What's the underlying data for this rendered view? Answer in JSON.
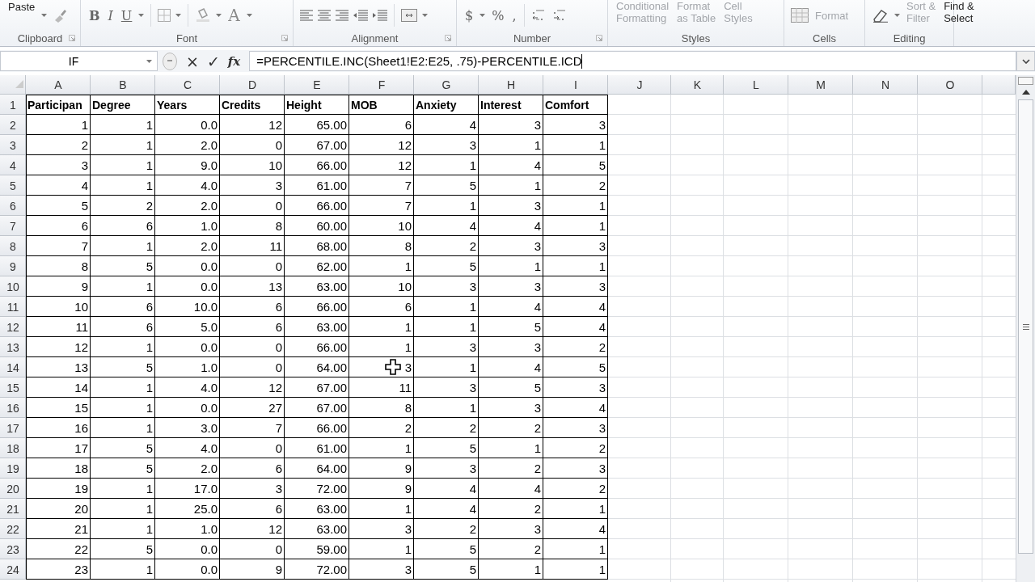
{
  "ribbon": {
    "groups": [
      {
        "label": "Clipboard",
        "buttons": [
          {
            "label": "Paste"
          }
        ]
      },
      {
        "label": "Font",
        "buttons": [
          {
            "label": "B"
          },
          {
            "label": "I"
          },
          {
            "label": "U"
          },
          {
            "label": "A"
          }
        ]
      },
      {
        "label": "Alignment"
      },
      {
        "label": "Number",
        "buttons": [
          {
            "label": "$"
          },
          {
            "label": "%"
          },
          {
            "label": ","
          }
        ]
      },
      {
        "label": "Styles",
        "buttons": [
          {
            "label": "Conditional\nFormatting",
            "disabled": true
          },
          {
            "label": "Format\nas Table",
            "disabled": true
          },
          {
            "label": "Cell\nStyles",
            "disabled": true
          }
        ]
      },
      {
        "label": "Cells",
        "buttons": [
          {
            "label": "Format",
            "disabled": true
          }
        ]
      },
      {
        "label": "Editing",
        "buttons": [
          {
            "label": "Sort &\nFilter",
            "disabled": true
          },
          {
            "label": "Find &\nSelect",
            "disabled": false
          }
        ]
      }
    ]
  },
  "formula_bar": {
    "name_box": "IF",
    "buttons": [
      "×",
      "✓",
      "fx"
    ],
    "formula": "=PERCENTILE.INC(Sheet1!E2:E25, .75)-PERCENTILE.ICD"
  },
  "sheet": {
    "columns": [
      "A",
      "B",
      "C",
      "D",
      "E",
      "F",
      "G",
      "H",
      "I",
      "J",
      "K",
      "L",
      "M",
      "N",
      "O"
    ],
    "header": {
      "number": "1",
      "cells": [
        "Participan",
        "Degree",
        "Years",
        "Credits",
        "Height",
        "MOB",
        "Anxiety",
        "Interest",
        "Comfort"
      ]
    },
    "rows": [
      {
        "number": "2",
        "cells": [
          "1",
          "1",
          "0.0",
          "12",
          "65.00",
          "6",
          "4",
          "3",
          "3"
        ]
      },
      {
        "number": "3",
        "cells": [
          "2",
          "1",
          "2.0",
          "0",
          "67.00",
          "12",
          "3",
          "1",
          "1"
        ]
      },
      {
        "number": "4",
        "cells": [
          "3",
          "1",
          "9.0",
          "10",
          "66.00",
          "12",
          "1",
          "4",
          "5"
        ]
      },
      {
        "number": "5",
        "cells": [
          "4",
          "1",
          "4.0",
          "3",
          "61.00",
          "7",
          "5",
          "1",
          "2"
        ]
      },
      {
        "number": "6",
        "cells": [
          "5",
          "2",
          "2.0",
          "0",
          "66.00",
          "7",
          "1",
          "3",
          "1"
        ]
      },
      {
        "number": "7",
        "cells": [
          "6",
          "6",
          "1.0",
          "8",
          "60.00",
          "10",
          "4",
          "4",
          "1"
        ]
      },
      {
        "number": "8",
        "cells": [
          "7",
          "1",
          "2.0",
          "11",
          "68.00",
          "8",
          "2",
          "3",
          "3"
        ]
      },
      {
        "number": "9",
        "cells": [
          "8",
          "5",
          "0.0",
          "0",
          "62.00",
          "1",
          "5",
          "1",
          "1"
        ]
      },
      {
        "number": "10",
        "cells": [
          "9",
          "1",
          "0.0",
          "13",
          "63.00",
          "10",
          "3",
          "3",
          "3"
        ]
      },
      {
        "number": "11",
        "cells": [
          "10",
          "6",
          "10.0",
          "6",
          "66.00",
          "6",
          "1",
          "4",
          "4"
        ]
      },
      {
        "number": "12",
        "cells": [
          "11",
          "6",
          "5.0",
          "6",
          "63.00",
          "1",
          "1",
          "5",
          "4"
        ]
      },
      {
        "number": "13",
        "cells": [
          "12",
          "1",
          "0.0",
          "0",
          "66.00",
          "1",
          "3",
          "3",
          "2"
        ]
      },
      {
        "number": "14",
        "cells": [
          "13",
          "5",
          "1.0",
          "0",
          "64.00",
          "3",
          "1",
          "4",
          "5"
        ]
      },
      {
        "number": "15",
        "cells": [
          "14",
          "1",
          "4.0",
          "12",
          "67.00",
          "11",
          "3",
          "5",
          "3"
        ]
      },
      {
        "number": "16",
        "cells": [
          "15",
          "1",
          "0.0",
          "27",
          "67.00",
          "8",
          "1",
          "3",
          "4"
        ]
      },
      {
        "number": "17",
        "cells": [
          "16",
          "1",
          "3.0",
          "7",
          "66.00",
          "2",
          "2",
          "2",
          "3"
        ]
      },
      {
        "number": "18",
        "cells": [
          "17",
          "5",
          "4.0",
          "0",
          "61.00",
          "1",
          "5",
          "1",
          "2"
        ]
      },
      {
        "number": "19",
        "cells": [
          "18",
          "5",
          "2.0",
          "6",
          "64.00",
          "9",
          "3",
          "2",
          "3"
        ]
      },
      {
        "number": "20",
        "cells": [
          "19",
          "1",
          "17.0",
          "3",
          "72.00",
          "9",
          "4",
          "4",
          "2"
        ]
      },
      {
        "number": "21",
        "cells": [
          "20",
          "1",
          "25.0",
          "6",
          "63.00",
          "1",
          "4",
          "2",
          "1"
        ]
      },
      {
        "number": "22",
        "cells": [
          "21",
          "1",
          "1.0",
          "12",
          "63.00",
          "3",
          "2",
          "3",
          "4"
        ]
      },
      {
        "number": "23",
        "cells": [
          "22",
          "5",
          "0.0",
          "0",
          "59.00",
          "1",
          "5",
          "2",
          "1"
        ]
      },
      {
        "number": "24",
        "cells": [
          "23",
          "1",
          "0.0",
          "9",
          "72.00",
          "3",
          "5",
          "1",
          "1"
        ]
      }
    ]
  }
}
